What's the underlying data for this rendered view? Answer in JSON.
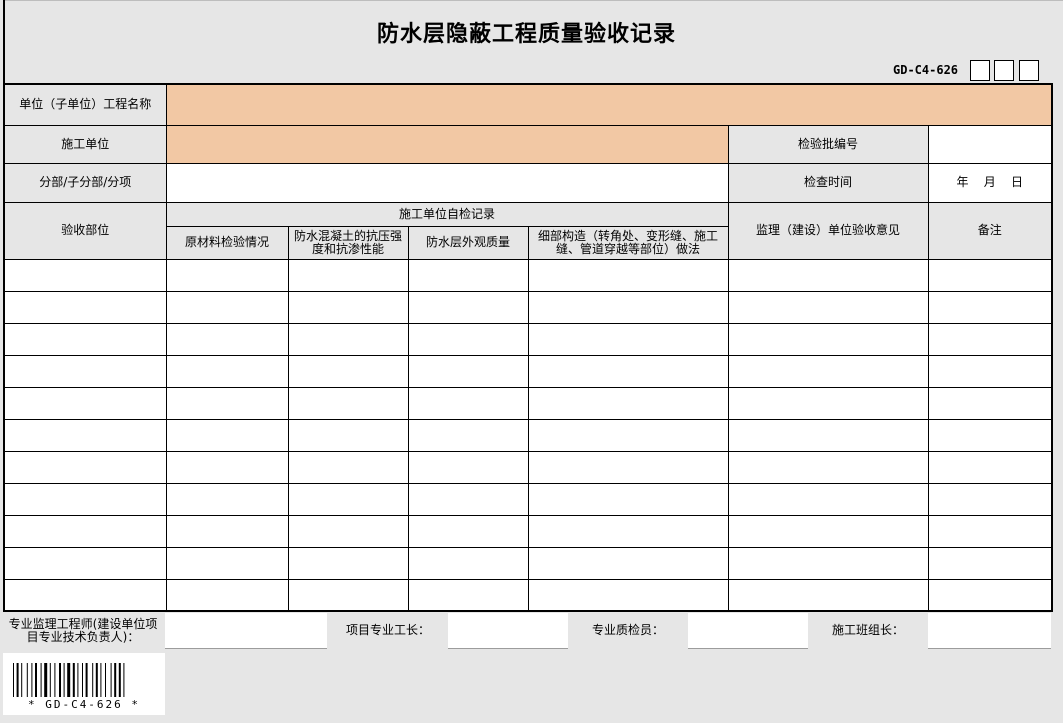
{
  "title": "防水层隐蔽工程质量验收记录",
  "form_code": "GD-C4-626",
  "labels": {
    "unit_project_name": "单位（子单位）工程名称",
    "construction_unit": "施工单位",
    "batch_no": "检验批编号",
    "sub_division": "分部/子分部/分项",
    "inspection_time": "检查时间",
    "date_placeholder": "年    月    日"
  },
  "table": {
    "col_location": "验收部位",
    "group_self_check": "施工单位自检记录",
    "col_material": "原材料检验情况",
    "col_concrete": "防水混凝土的抗压强度和抗渗性能",
    "col_appearance": "防水层外观质量",
    "col_details": "细部构造（转角处、变形缝、施工缝、管道穿越等部位）做法",
    "col_supervision": "监理（建设）单位验收意见",
    "col_remarks": "备注",
    "rows": [
      "",
      "",
      "",
      "",
      "",
      "",
      "",
      "",
      "",
      "",
      ""
    ]
  },
  "signatures": {
    "engineer": "专业监理工程师(建设单位项目专业技术负责人)：",
    "foreman": "项目专业工长：",
    "inspector": "专业质检员：",
    "team_leader": "施工班组长："
  },
  "barcode_text": "* GD-C4-626 *"
}
